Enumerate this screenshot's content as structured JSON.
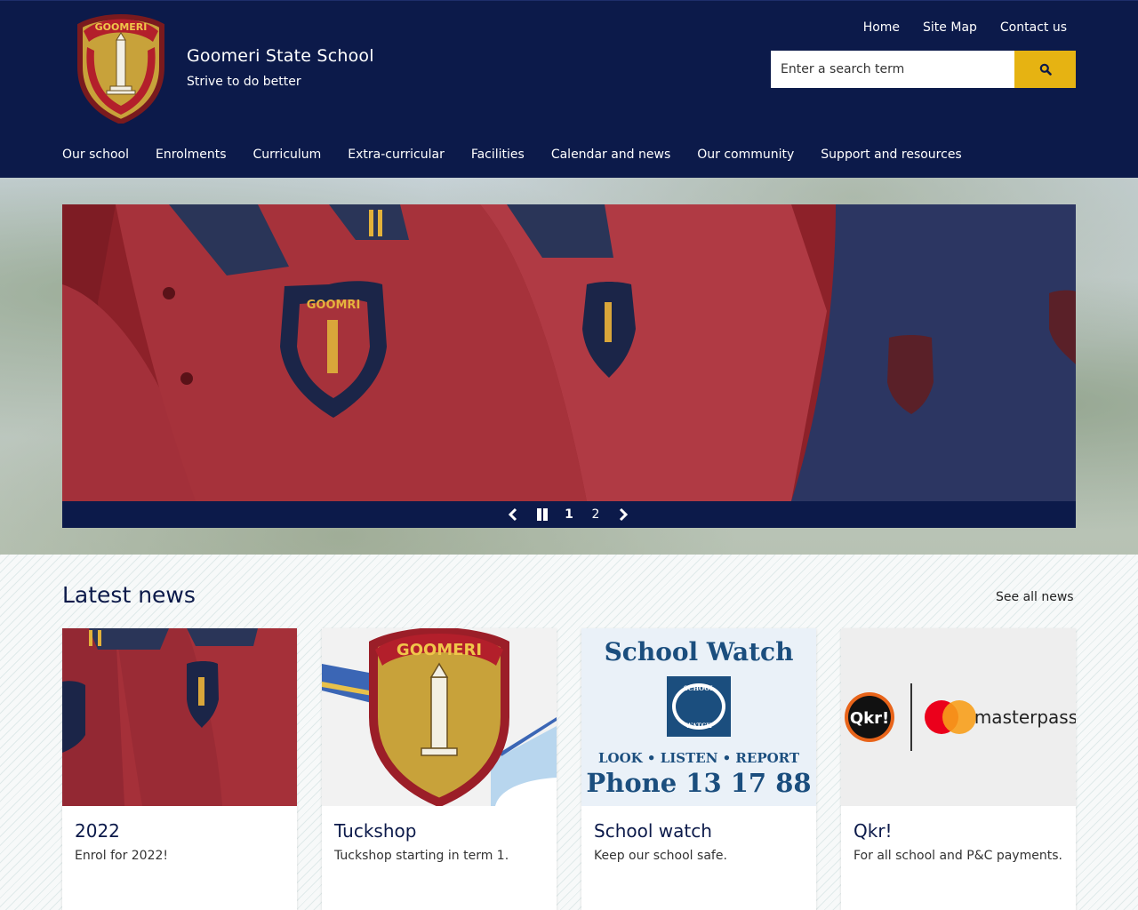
{
  "header": {
    "site_title": "Goomeri State School",
    "tagline": "Strive to do better",
    "crest_lettering": "GOOMERI STRIVE TO DO BETTER",
    "utility_links": [
      {
        "label": "Home"
      },
      {
        "label": "Site Map"
      },
      {
        "label": "Contact us"
      }
    ],
    "search": {
      "placeholder": "Enter a search term",
      "button_icon": "search-icon"
    },
    "nav": [
      {
        "label": "Our school"
      },
      {
        "label": "Enrolments"
      },
      {
        "label": "Curriculum"
      },
      {
        "label": "Extra-curricular"
      },
      {
        "label": "Facilities"
      },
      {
        "label": "Calendar and news"
      },
      {
        "label": "Our community"
      },
      {
        "label": "Support and resources"
      }
    ]
  },
  "carousel": {
    "prev_icon": "chevron-left-icon",
    "pause_icon": "pause-icon",
    "next_icon": "chevron-right-icon",
    "pages": [
      "1",
      "2"
    ],
    "active_page": "1"
  },
  "news": {
    "heading": "Latest news",
    "see_all": "See all news",
    "cards": [
      {
        "title": "2022",
        "text": "Enrol for 2022!"
      },
      {
        "title": "Tuckshop",
        "text": "Tuckshop starting in term 1."
      },
      {
        "title": "School watch",
        "text": "Keep our school safe."
      },
      {
        "title": "Qkr!",
        "text": "For all school and P&C payments."
      }
    ],
    "school_watch_image": {
      "heading": "School Watch",
      "badge_top": "SCHOOL",
      "badge_bottom": "WATCH",
      "slogan": "LOOK • LISTEN • REPORT",
      "phone": "Phone 13 17 88"
    },
    "qkr_image": {
      "logo": "Qkr!",
      "partner": "masterpass"
    }
  },
  "colors": {
    "navy": "#0c1a4a",
    "gold": "#e6b312",
    "maroon": "#a8262f",
    "mastercard_red": "#eb001b",
    "mastercard_orange": "#f79e1b"
  }
}
